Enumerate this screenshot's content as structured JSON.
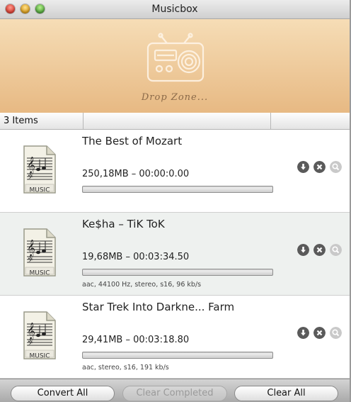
{
  "window": {
    "title": "Musicbox"
  },
  "dropzone": {
    "label": "Drop Zone..."
  },
  "list": {
    "count_label": "3 Items",
    "items": [
      {
        "name": "The Best of Mozart",
        "info": "250,18MB – 00:00:0.00",
        "meta": "",
        "progress": 0,
        "icon": "music-file-icon"
      },
      {
        "name": "Ke$ha – TiK ToK",
        "info": "19,68MB – 00:03:34.50",
        "meta": "aac, 44100 Hz, stereo, s16, 96 kb/s",
        "progress": 0,
        "icon": "music-file-icon"
      },
      {
        "name": "Star Trek Into Darkne... Farm",
        "info": "29,41MB – 00:03:18.80",
        "meta": "aac, stereo, s16, 191 kb/s",
        "progress": 0,
        "icon": "music-file-icon"
      }
    ],
    "file_icon_label": "MUSIC"
  },
  "row_actions": [
    "download-icon",
    "close-icon",
    "search-icon"
  ],
  "toolbar": {
    "convert_all": "Convert All",
    "clear_completed": "Clear Completed",
    "clear_all": "Clear All"
  },
  "colors": {
    "dropzone_top": "#f6ddb6",
    "dropzone_bottom": "#e7b983",
    "progress_fill": "#7fa6d6"
  }
}
